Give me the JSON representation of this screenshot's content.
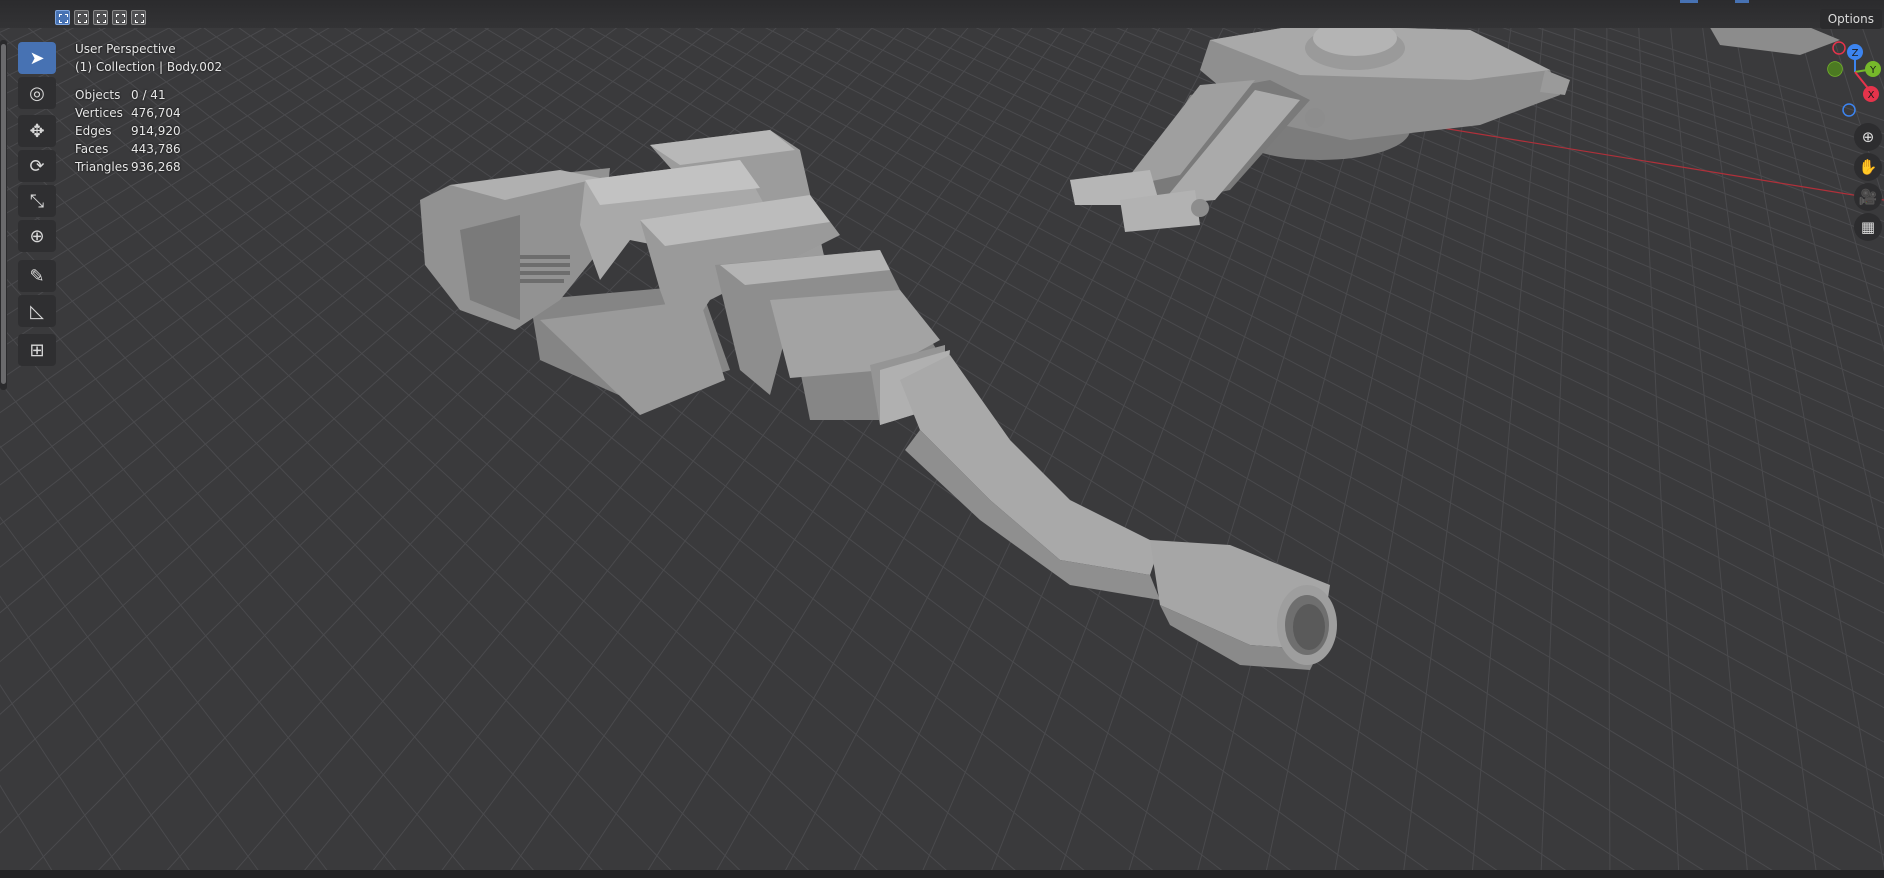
{
  "header": {
    "select_modes": [
      "set-new",
      "extend",
      "subtract",
      "difference",
      "intersect"
    ],
    "options_label": "Options"
  },
  "toolbar": {
    "tools": [
      {
        "name": "select-box-tool",
        "icon": "cursor-arrow-icon",
        "glyph": "➤",
        "active": true
      },
      {
        "name": "cursor-tool",
        "icon": "crosshair-circle-icon",
        "glyph": "◎",
        "active": false
      },
      {
        "name": "move-tool",
        "icon": "move-arrows-icon",
        "glyph": "✥",
        "active": false
      },
      {
        "name": "rotate-tool",
        "icon": "rotate-icon",
        "glyph": "⟳",
        "active": false
      },
      {
        "name": "scale-tool",
        "icon": "scale-icon",
        "glyph": "⤡",
        "active": false
      },
      {
        "name": "transform-tool",
        "icon": "transform-icon",
        "glyph": "⊕",
        "active": false
      },
      {
        "name": "annotate-tool",
        "icon": "pencil-icon",
        "glyph": "✎",
        "active": false
      },
      {
        "name": "measure-tool",
        "icon": "ruler-icon",
        "glyph": "◺",
        "active": false
      },
      {
        "name": "add-cube-tool",
        "icon": "add-cube-icon",
        "glyph": "⊞",
        "active": false
      }
    ]
  },
  "overlay": {
    "view_name": "User Perspective",
    "collection": "(1) Collection | Body.002",
    "stats": [
      {
        "label": "Objects",
        "value": "0 / 41"
      },
      {
        "label": "Vertices",
        "value": "476,704"
      },
      {
        "label": "Edges",
        "value": "914,920"
      },
      {
        "label": "Faces",
        "value": "443,786"
      },
      {
        "label": "Triangles",
        "value": "936,268"
      }
    ]
  },
  "gizmo": {
    "axes": [
      {
        "label": "Z",
        "color": "#3c84f0"
      },
      {
        "label": "Y",
        "color": "#76b82a"
      },
      {
        "label": "X",
        "color": "#e5334b"
      }
    ]
  },
  "nav_buttons": [
    {
      "name": "zoom-button",
      "icon": "magnifier-icon",
      "glyph": "⊕"
    },
    {
      "name": "pan-button",
      "icon": "hand-icon",
      "glyph": "✋"
    },
    {
      "name": "camera-view-button",
      "icon": "camera-icon",
      "glyph": "🎥"
    },
    {
      "name": "perspective-toggle-button",
      "icon": "grid-icon",
      "glyph": "▦"
    }
  ],
  "colors": {
    "viewport_bg": "#3a3a3c",
    "grid": "#4a4a4d",
    "accent": "#4772b3",
    "x_axis_line": "#b0303a",
    "model_light": "#a5a5a5",
    "model_mid": "#8d8d8d",
    "model_dark": "#6e6e6e"
  }
}
